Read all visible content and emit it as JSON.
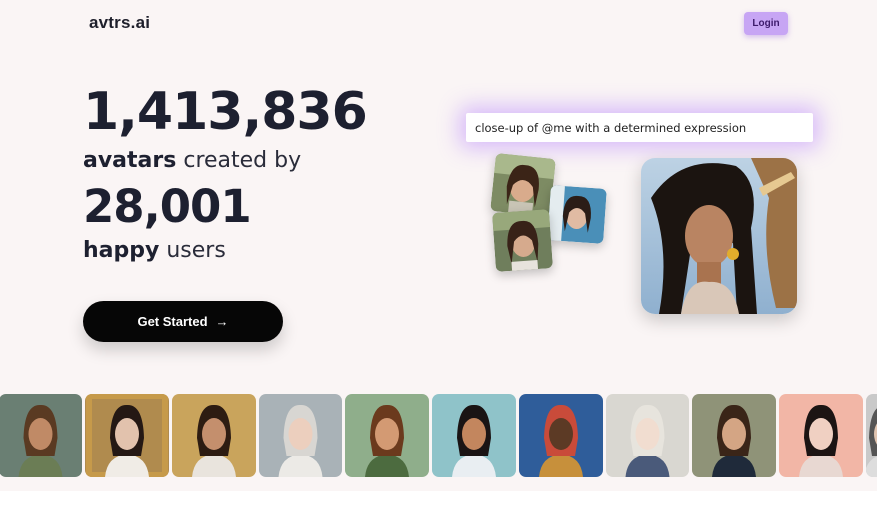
{
  "header": {
    "logo": "avtrs.ai",
    "login_label": "Login"
  },
  "stats": {
    "avatars_count": "1,413,836",
    "avatars_word": "avatars",
    "created_by": "created by",
    "users_count": "28,001",
    "users_word": "happy",
    "users_suffix": "users"
  },
  "cta": {
    "label": "Get Started",
    "arrow": "→"
  },
  "prompt": {
    "text": "close-up of @me with a determined expression"
  },
  "colors": {
    "accent": "#c7a5f4",
    "background": "#faf5f5",
    "cta_bg": "#060606"
  }
}
